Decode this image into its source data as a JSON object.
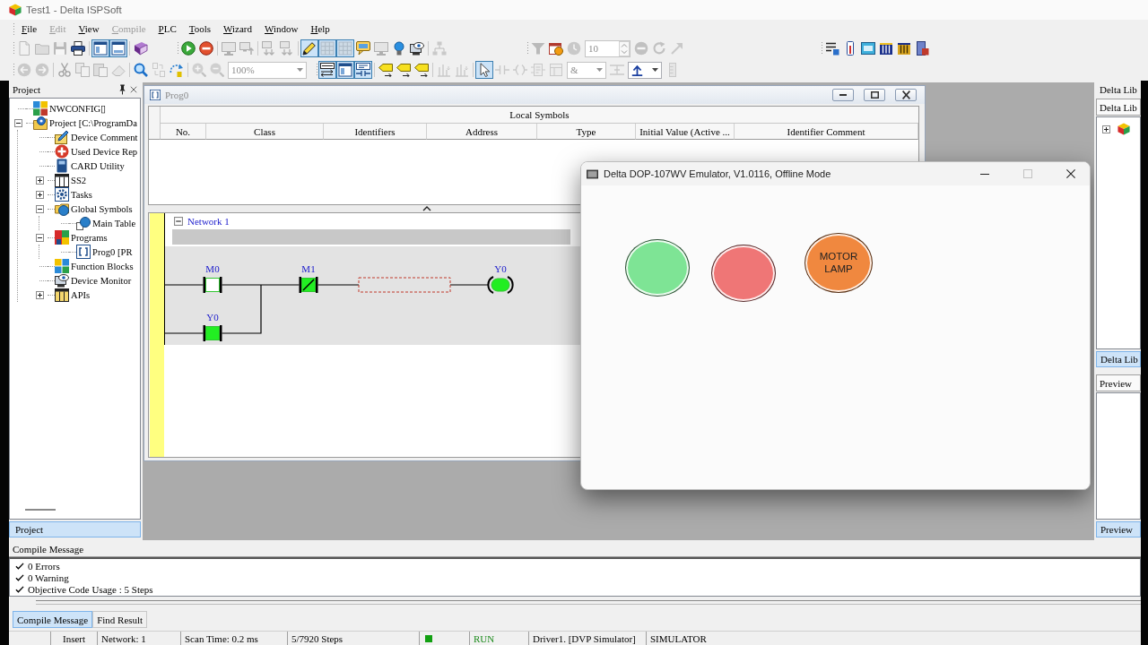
{
  "window": {
    "title": "Test1 - Delta ISPSoft"
  },
  "menu": [
    {
      "label": "File",
      "disabled": false
    },
    {
      "label": "Edit",
      "disabled": true
    },
    {
      "label": "View",
      "disabled": false
    },
    {
      "label": "Compile",
      "disabled": true
    },
    {
      "label": "PLC",
      "disabled": false
    },
    {
      "label": "Tools",
      "disabled": false
    },
    {
      "label": "Wizard",
      "disabled": false
    },
    {
      "label": "Window",
      "disabled": false
    },
    {
      "label": "Help",
      "disabled": false
    }
  ],
  "toolbar_rows": [
    [
      {
        "groups": [
          [
            {
              "kind": "button",
              "pressed": false,
              "disabled": true
            },
            {
              "kind": "button",
              "pressed": false,
              "disabled": true
            },
            {
              "kind": "button",
              "pressed": false,
              "disabled": true
            },
            {
              "kind": "button",
              "pressed": false,
              "disabled": false
            }
          ],
          [
            {
              "kind": "button",
              "pressed": true,
              "disabled": false
            },
            {
              "kind": "button",
              "pressed": true,
              "disabled": false
            }
          ],
          [
            {
              "kind": "button",
              "pressed": false,
              "disabled": false
            }
          ]
        ]
      },
      {
        "groups": [
          [
            {
              "kind": "button",
              "pressed": false,
              "disabled": false
            },
            {
              "kind": "button",
              "pressed": false,
              "disabled": false
            }
          ],
          [
            {
              "kind": "button",
              "pressed": false,
              "disabled": true
            },
            {
              "kind": "button",
              "pressed": false,
              "disabled": true
            }
          ],
          [
            {
              "kind": "button",
              "pressed": false,
              "disabled": true
            },
            {
              "kind": "button",
              "pressed": false,
              "disabled": true
            }
          ],
          [
            {
              "kind": "button",
              "pressed": true,
              "disabled": false
            },
            {
              "kind": "button",
              "pressed": true,
              "disabled": true
            },
            {
              "kind": "button",
              "pressed": true,
              "disabled": true
            },
            {
              "kind": "button",
              "pressed": false,
              "disabled": false
            },
            {
              "kind": "button",
              "pressed": false,
              "disabled": true
            },
            {
              "kind": "button",
              "pressed": false,
              "disabled": false
            },
            {
              "kind": "button",
              "pressed": false,
              "disabled": false
            }
          ],
          [
            {
              "kind": "button",
              "pressed": false,
              "disabled": true
            }
          ]
        ]
      },
      {
        "groups": [
          [
            {
              "kind": "button",
              "pressed": false,
              "disabled": true
            },
            {
              "kind": "button",
              "pressed": false,
              "disabled": false
            },
            {
              "kind": "button",
              "pressed": false,
              "disabled": true
            },
            {
              "kind": "spin",
              "value": "10",
              "disabled": true
            },
            {
              "kind": "button",
              "pressed": false,
              "disabled": true
            },
            {
              "kind": "button",
              "pressed": false,
              "disabled": true
            },
            {
              "kind": "button",
              "pressed": false,
              "disabled": true
            }
          ]
        ]
      },
      {
        "groups": [
          [
            {
              "kind": "button",
              "pressed": false,
              "disabled": false
            },
            {
              "kind": "button",
              "pressed": false,
              "disabled": false
            },
            {
              "kind": "button",
              "pressed": false,
              "disabled": false
            },
            {
              "kind": "button",
              "pressed": false,
              "disabled": false
            },
            {
              "kind": "button",
              "pressed": false,
              "disabled": false
            },
            {
              "kind": "button",
              "pressed": false,
              "disabled": false
            }
          ]
        ]
      }
    ],
    [
      {
        "groups": [
          [
            {
              "kind": "button",
              "pressed": false,
              "disabled": true
            },
            {
              "kind": "button",
              "pressed": false,
              "disabled": true
            }
          ],
          [
            {
              "kind": "button",
              "pressed": false,
              "disabled": true
            },
            {
              "kind": "button",
              "pressed": false,
              "disabled": true
            },
            {
              "kind": "button",
              "pressed": false,
              "disabled": true
            },
            {
              "kind": "button",
              "pressed": false,
              "disabled": true
            }
          ],
          [
            {
              "kind": "button",
              "pressed": false,
              "disabled": false
            },
            {
              "kind": "button",
              "pressed": false,
              "disabled": true
            },
            {
              "kind": "button",
              "pressed": false,
              "disabled": false
            }
          ],
          [
            {
              "kind": "button",
              "pressed": false,
              "disabled": true
            },
            {
              "kind": "button",
              "pressed": false,
              "disabled": true
            },
            {
              "kind": "combo",
              "value": "100%",
              "disabled": true
            }
          ]
        ]
      },
      {
        "groups": [
          [
            {
              "kind": "button",
              "pressed": true,
              "disabled": false
            },
            {
              "kind": "button",
              "pressed": true,
              "disabled": false
            },
            {
              "kind": "button",
              "pressed": true,
              "disabled": false
            }
          ],
          [
            {
              "kind": "button",
              "pressed": false,
              "disabled": false
            },
            {
              "kind": "button",
              "pressed": false,
              "disabled": false
            },
            {
              "kind": "button",
              "pressed": false,
              "disabled": false
            }
          ],
          [
            {
              "kind": "button",
              "pressed": false,
              "disabled": true
            },
            {
              "kind": "button",
              "pressed": false,
              "disabled": true
            }
          ],
          [
            {
              "kind": "button",
              "pressed": true,
              "disabled": false
            },
            {
              "kind": "button",
              "pressed": false,
              "disabled": true
            },
            {
              "kind": "button",
              "pressed": false,
              "disabled": true
            },
            {
              "kind": "button",
              "pressed": false,
              "disabled": true
            },
            {
              "kind": "button",
              "pressed": false,
              "disabled": true
            },
            {
              "kind": "combo",
              "value": "&",
              "disabled": true
            },
            {
              "kind": "button",
              "pressed": false,
              "disabled": true
            },
            {
              "kind": "combo",
              "disabled": false
            },
            {
              "kind": "button",
              "pressed": false,
              "disabled": true
            }
          ]
        ]
      }
    ]
  ],
  "project_panel": {
    "title": "Project",
    "tree": [
      {
        "label": "NWCONFIG▯",
        "kind": "network"
      },
      {
        "label": "Project [C:\\ProgramDa",
        "kind": "project",
        "expanded": true,
        "children": [
          {
            "label": "Device Comment",
            "kind": "comment"
          },
          {
            "label": "Used Device Rep",
            "kind": "device_list"
          },
          {
            "label": "CARD Utility",
            "kind": "card"
          },
          {
            "label": "SS2",
            "kind": "station",
            "expanded": false
          },
          {
            "label": "Tasks",
            "kind": "tasks",
            "expanded": false
          },
          {
            "label": "Global Symbols",
            "kind": "symbols",
            "expanded": true,
            "children": [
              {
                "label": "Main Table",
                "kind": "symbol_table"
              }
            ]
          },
          {
            "label": "Programs",
            "kind": "programs",
            "expanded": true,
            "children": [
              {
                "label": "Prog0 [PR",
                "kind": "program"
              }
            ]
          },
          {
            "label": "Function Blocks",
            "kind": "function_blocks"
          },
          {
            "label": "Device Monitor",
            "kind": "monitor"
          },
          {
            "label": "APIs",
            "kind": "apis",
            "expanded": false
          }
        ]
      }
    ],
    "tabs": [
      {
        "label": "Project",
        "selected": true
      }
    ]
  },
  "editor": {
    "title": "Prog0",
    "active": false,
    "symbols": {
      "title": "Local Symbols",
      "columns": [
        "No.",
        "Class",
        "Identifiers",
        "Address",
        "Type",
        "Initial Value (Active ...",
        "Identifier Comment"
      ]
    },
    "ladder": {
      "networks": [
        {
          "label": "Network 1",
          "expanded": true,
          "rows": [
            {
              "elements": [
                {
                  "kind": "contact",
                  "operand": "M0",
                  "normally_closed": false,
                  "on": false
                },
                {
                  "kind": "contact",
                  "operand": "M1",
                  "normally_closed": true,
                  "on": true
                },
                {
                  "kind": "cursor"
                },
                {
                  "kind": "coil",
                  "operand": "Y0",
                  "on": true
                }
              ]
            },
            {
              "elements": [
                {
                  "kind": "contact",
                  "operand": "Y0",
                  "normally_closed": false,
                  "on": true
                }
              ]
            }
          ]
        }
      ]
    }
  },
  "emulator": {
    "title": "Delta DOP-107WV Emulator, V1.0116, Offline Mode",
    "controls": [
      {
        "kind": "minimize",
        "disabled": false
      },
      {
        "kind": "maximize",
        "disabled": true
      },
      {
        "kind": "close",
        "disabled": false
      }
    ],
    "objects": [
      {
        "kind": "lamp",
        "color": "#7ee495"
      },
      {
        "kind": "lamp",
        "color": "#ef7676"
      },
      {
        "kind": "lamp",
        "color": "#f0883f",
        "label": "MOTOR LAMP"
      }
    ]
  },
  "library_panel": {
    "title": "Delta Lib",
    "header": "Delta Lib",
    "tree": [
      {
        "expanded": false
      }
    ],
    "tabs": [
      {
        "label": "Delta Lib",
        "selected": true
      }
    ]
  },
  "preview_panel": {
    "header": "Preview",
    "tabs": [
      {
        "label": "Preview",
        "selected": true
      }
    ]
  },
  "output": {
    "title": "Compile Message",
    "messages": [
      "0 Errors",
      "0 Warning",
      "Objective Code Usage : 5 Steps"
    ],
    "tabs": [
      {
        "label": "Compile Message",
        "selected": true
      },
      {
        "label": "Find Result",
        "selected": false
      }
    ]
  },
  "status_bar": {
    "mode": "Insert",
    "network": "Network: 1",
    "scan_time": "Scan Time: 0.2 ms",
    "steps": "5/7920 Steps",
    "run_indicator": true,
    "plc_state": "RUN",
    "driver": "Driver1. [DVP Simulator]",
    "connection": "SIMULATOR"
  }
}
